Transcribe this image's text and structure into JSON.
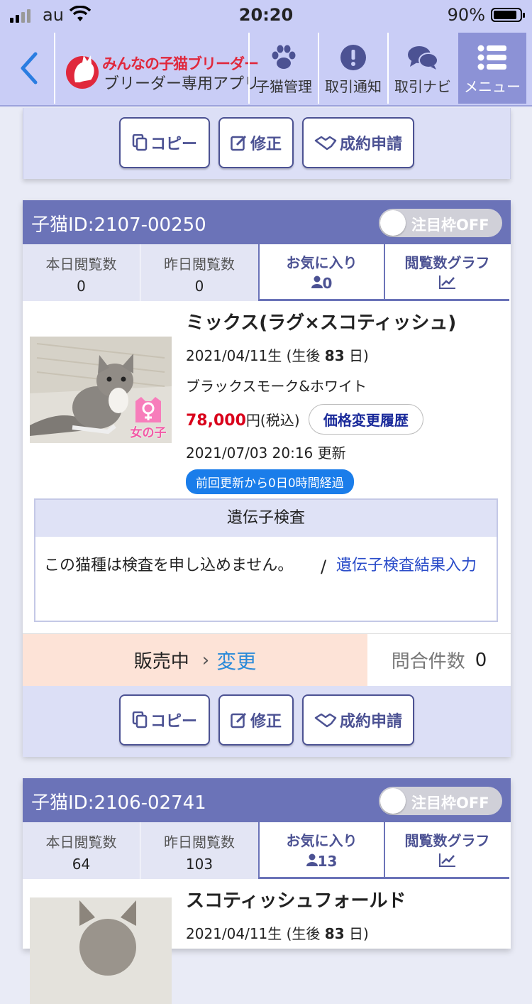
{
  "status": {
    "carrier": "au",
    "time": "20:20",
    "battery": "90%",
    "battery_level": 0.9
  },
  "nav": {
    "brand": "みんなの子猫ブリーダー",
    "subtitle": "ブリーダー専用アプリ",
    "items": [
      {
        "label": "子猫管理",
        "icon": "paw-icon"
      },
      {
        "label": "取引通知",
        "icon": "alert-icon"
      },
      {
        "label": "取引ナビ",
        "icon": "chat-icon"
      },
      {
        "label": "メニュー",
        "icon": "menu-icon"
      }
    ]
  },
  "actions": {
    "copy": "コピー",
    "edit": "修正",
    "contract": "成約申請"
  },
  "labels": {
    "today_views": "本日閲覧数",
    "yesterday_views": "昨日閲覧数",
    "favorites": "お気に入り",
    "views_graph": "閲覧数グラフ",
    "featured_toggle": "注目枠OFF",
    "price_history": "価格変更履歴",
    "tax_suffix": "円(税込)",
    "updated_suffix": "更新",
    "gene_title": "遺伝子検査",
    "gene_note": "この猫種は検査を申し込めません。",
    "gene_link": "遺伝子検査結果入力",
    "sale_status": "販売中",
    "sale_change": "変更",
    "inquiry_label": "問合件数",
    "female_badge": "女の子"
  },
  "kittens": [
    {
      "id": "子猫ID:2107-00250",
      "today": "0",
      "yesterday": "0",
      "favorites": "0",
      "breed": "ミックス(ラグ×スコティッシュ)",
      "birth": "2021/04/11生 (生後",
      "age_days": "83",
      "birth_suffix": "日)",
      "color": "ブラックスモーク&ホワイト",
      "price": "78,000",
      "updated": "2021/07/03 20:16",
      "elapsed": "前回更新から0日0時間経過",
      "inquiries": "0"
    },
    {
      "id": "子猫ID:2106-02741",
      "today": "64",
      "yesterday": "103",
      "favorites": "13",
      "breed": "スコティッシュフォールド",
      "birth": "2021/04/11生 (生後",
      "age_days": "83",
      "birth_suffix": "日)"
    }
  ]
}
